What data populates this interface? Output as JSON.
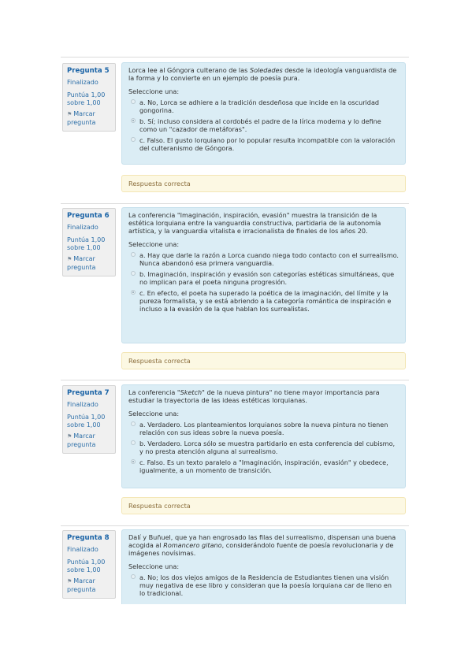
{
  "questions": [
    {
      "number": "Pregunta 5",
      "state": "Finalizado",
      "grade": "Puntúa 1,00 sobre 1,00",
      "flag": "Marcar pregunta",
      "text_before": "Lorca lee al Góngora culterano de las ",
      "text_em": "Soledades",
      "text_after": " desde la ideología vanguardista de la forma y lo convierte en un ejemplo de poesía pura.",
      "prompt": "Seleccione una:",
      "answers": [
        "a. No, Lorca se adhiere a la tradición desdeñosa que incide en la oscuridad gongorina.",
        "b. Sí; incluso considera al cordobés el padre de la lírica moderna y lo define como un \"cazador de metáforas\".",
        "c. Falso. El gusto lorquiano por lo popular resulta incompatible con la valoración del culteranismo de Góngora."
      ],
      "feedback": "Respuesta correcta"
    },
    {
      "number": "Pregunta 6",
      "state": "Finalizado",
      "grade": "Puntúa 1,00 sobre 1,00",
      "flag": "Marcar pregunta",
      "text_before": "La conferencia \"Imaginación, inspiración, evasión\" muestra la transición de la estética lorquiana entre la vanguardia constructiva, partidaria de la autonomía artística, y la vanguardia vitalista e irracionalista de finales de los años 20.",
      "text_em": "",
      "text_after": "",
      "prompt": "Seleccione una:",
      "answers": [
        "a. Hay que darle la razón a Lorca cuando niega todo contacto con el surrealismo. Nunca abandonó esa primera vanguardia.",
        "b. Imaginación, inspiración y evasión son categorías estéticas simultáneas, que no implican para el poeta ninguna progresión.",
        "c. En efecto, el poeta ha superado la poética de la imaginación, del límite y la pureza formalista, y se está abriendo a la categoría romántica de inspiración e incluso a la evasión de la que hablan los surrealistas."
      ],
      "feedback": "Respuesta correcta"
    },
    {
      "number": "Pregunta 7",
      "state": "Finalizado",
      "grade": "Puntúa 1,00 sobre 1,00",
      "flag": "Marcar pregunta",
      "text_before": "La conferencia ",
      "text_em": "\"Sketch\"",
      "text_after": " de la nueva pintura\" no tiene mayor importancia para estudiar la trayectoria de las ideas estéticas lorquianas.",
      "prompt": "Seleccione una:",
      "answers": [
        "a. Verdadero. Los planteamientos lorquianos sobre la nueva pintura no tienen relación  con sus ideas sobre la nueva poesía.",
        "b. Verdadero. Lorca sólo se muestra partidario en esta conferencia del cubismo, y no presta atención alguna al surrealismo.",
        "c. Falso. Es un texto paralelo a \"Imaginación, inspiración, evasión\" y obedece, igualmente, a un momento de transición."
      ],
      "feedback": "Respuesta correcta"
    },
    {
      "number": "Pregunta 8",
      "state": "Finalizado",
      "grade": "Puntúa 1,00 sobre 1,00",
      "flag": "Marcar pregunta",
      "text_before": "Dalí y Buñuel, que ya han engrosado las filas del surrealismo, dispensan una buena acogida al ",
      "text_em": "Romancero gitano",
      "text_after": ", considerándolo fuente de poesía revolucionaria y de imágenes novísimas.",
      "prompt": "Seleccione una:",
      "answers": [
        "a. No; los dos viejos amigos de la Residencia de Estudiantes tienen una visión muy negativa de ese libro y consideran que la poesía lorquiana car de lleno en lo tradicional."
      ],
      "feedback": ""
    }
  ]
}
